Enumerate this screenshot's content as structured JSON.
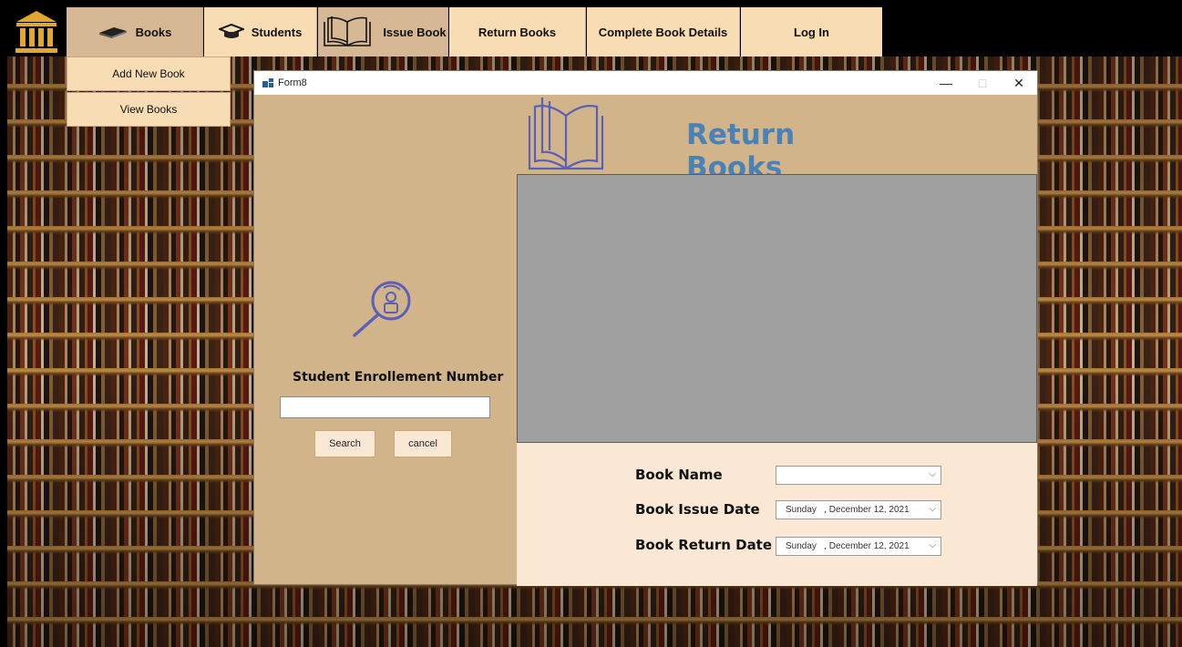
{
  "nav": {
    "items": [
      {
        "label": "Books",
        "icon": "book-icon"
      },
      {
        "label": "Students",
        "icon": "graduation-cap-icon"
      },
      {
        "label": "Issue Book",
        "icon": "open-book-icon"
      },
      {
        "label": "Return Books"
      },
      {
        "label": "Complete Book Details"
      },
      {
        "label": "Log In"
      }
    ],
    "dropdown": [
      "Add New Book",
      "View Books"
    ]
  },
  "window": {
    "title": "Form8",
    "controls": {
      "minimize": "—",
      "maximize": "□",
      "close": "✕"
    },
    "heading": "Return Books"
  },
  "search": {
    "label": "Student Enrollement Number",
    "value": "",
    "search_button": "Search",
    "cancel_button": "cancel"
  },
  "details": {
    "book_name_label": "Book Name",
    "book_name_value": "",
    "issue_date_label": "Book Issue Date",
    "issue_date_value": "Sunday   , December 12, 2021",
    "return_date_label": "Book Return Date",
    "return_date_value": "Sunday   , December 12, 2021"
  },
  "colors": {
    "nav_bg": "#f8dcb4",
    "form_bg": "#d2b48a",
    "heading": "#4a82b8",
    "icon_blue": "#5a5fb8",
    "grid_bg": "#a0a0a0",
    "panel_bg": "#fae8d4"
  }
}
